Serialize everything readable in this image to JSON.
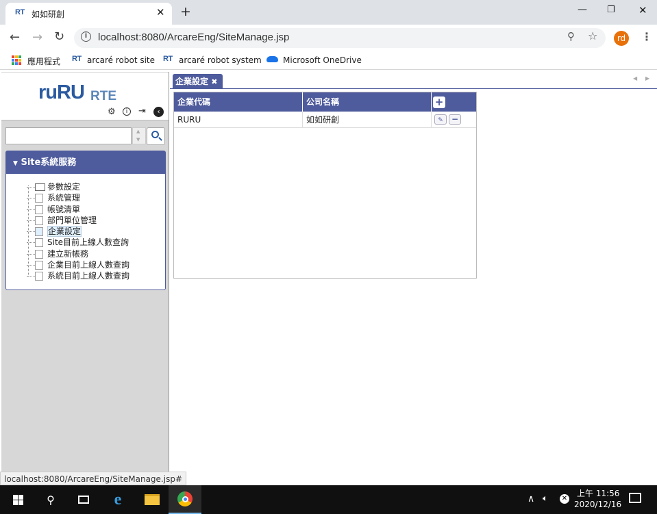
{
  "browser": {
    "tab_title": "如如研創",
    "favicon": "RT",
    "url": "localhost:8080/ArcareEng/SiteManage.jsp",
    "profile_initials": "rd",
    "bookmarks": [
      {
        "label": "應用程式",
        "icon": "apps-icon"
      },
      {
        "label": "arcaré robot site",
        "icon": "RT"
      },
      {
        "label": "arcaré robot system",
        "icon": "RT"
      },
      {
        "label": "Microsoft OneDrive",
        "icon": "onedrive-icon"
      }
    ]
  },
  "app": {
    "logo_text": "ruRU",
    "logo_suffix": "RTE",
    "sidebar": {
      "search_value": "",
      "section_title": "Site系統服務",
      "tree": [
        {
          "label": "參數設定",
          "type": "folder",
          "selected": false
        },
        {
          "label": "系統管理",
          "type": "file",
          "selected": false
        },
        {
          "label": "帳號清單",
          "type": "file",
          "selected": false
        },
        {
          "label": "部門單位管理",
          "type": "file",
          "selected": false
        },
        {
          "label": "企業設定",
          "type": "file",
          "selected": true
        },
        {
          "label": "Site目前上線人數查詢",
          "type": "file",
          "selected": false
        },
        {
          "label": "建立新帳務",
          "type": "file",
          "selected": false
        },
        {
          "label": "企業目前上線人數查詢",
          "type": "file",
          "selected": false
        },
        {
          "label": "系統目前上線人數查詢",
          "type": "file",
          "selected": false
        }
      ]
    },
    "main": {
      "tab_label": "企業設定",
      "table": {
        "columns": [
          "企業代碼",
          "公司名稱"
        ],
        "rows": [
          [
            "RURU",
            "如如研創"
          ]
        ]
      }
    }
  },
  "statusbar": {
    "text": "localhost:8080/ArcareEng/SiteManage.jsp#"
  },
  "taskbar": {
    "time": "上午 11:56",
    "date": "2020/12/16"
  },
  "colors": {
    "accent": "#4e5b9c",
    "logo_blue": "#2b5aa0"
  }
}
